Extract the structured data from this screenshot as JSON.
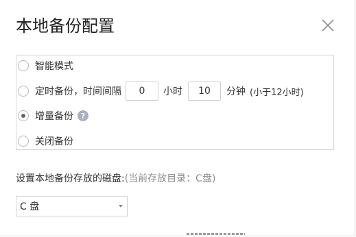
{
  "dialog": {
    "title": "本地备份配置",
    "close_icon": "close-icon"
  },
  "options": [
    {
      "label": "智能模式",
      "checked": false
    },
    {
      "label": "定时备份，时间间隔",
      "checked": false
    },
    {
      "label": "增量备份",
      "checked": true
    },
    {
      "label": "关闭备份",
      "checked": false
    }
  ],
  "scheduled": {
    "hours_value": "0",
    "hours_unit": "小时",
    "minutes_value": "10",
    "minutes_unit": "分钟",
    "note": "(小于12小时)"
  },
  "help_icon": {
    "name": "question-icon",
    "glyph": "?"
  },
  "disk": {
    "label": "设置本地备份存放的磁盘:",
    "hint": "(当前存放目录：C盘)",
    "selected": "C 盘"
  },
  "colors": {
    "border": "#d6d6d6",
    "help_icon_bg": "#a9b0bf",
    "hint_text": "#8a8a8a"
  }
}
